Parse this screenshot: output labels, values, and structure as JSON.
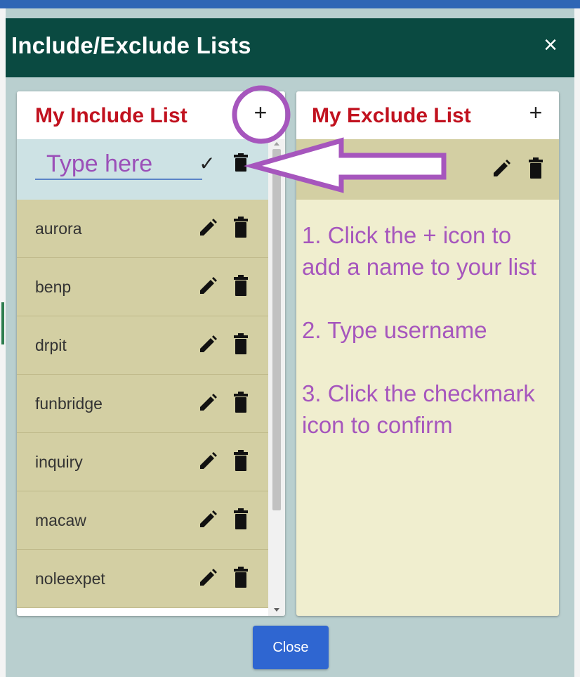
{
  "dialog": {
    "title": "Include/Exclude Lists",
    "close_icon": "×",
    "close_button_label": "Close"
  },
  "include_list": {
    "title": "My Include List",
    "add_icon": "+",
    "input_placeholder": "Type here",
    "confirm_icon": "✓",
    "items": [
      {
        "name": "aurora"
      },
      {
        "name": "benp"
      },
      {
        "name": "drpit"
      },
      {
        "name": "funbridge"
      },
      {
        "name": "inquiry"
      },
      {
        "name": "macaw"
      },
      {
        "name": "noleexpet"
      }
    ]
  },
  "exclude_list": {
    "title": "My Exclude List",
    "add_icon": "+"
  },
  "instructions": {
    "step1": "1. Click the + icon to add a name to your list",
    "step2": "2. Type username",
    "step3": "3. Click the checkmark icon to confirm"
  },
  "colors": {
    "title_bar": "#0a4a41",
    "panel_title": "#c1121f",
    "annotation": "#a656bd",
    "list_item_bg": "#d3cfa3",
    "button_blue": "#2f66d1"
  },
  "icons": {
    "add": "plus-icon",
    "confirm": "check-icon",
    "edit": "pencil-icon",
    "delete": "trash-icon",
    "close": "close-icon"
  }
}
